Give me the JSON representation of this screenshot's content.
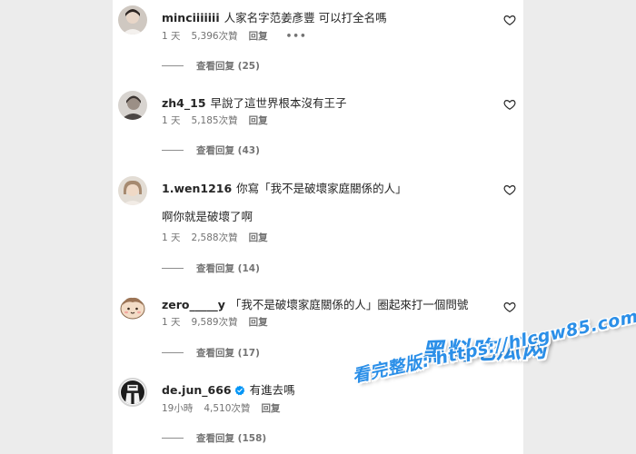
{
  "comments": [
    {
      "username": "minciiiiiii",
      "text": "人家名字范姜彥豐 可以打全名嗎",
      "extra": "",
      "time": "1 天",
      "likes": "5,396次贊",
      "reply_label": "回复",
      "more": "•••",
      "view_replies": "查看回复 (25)"
    },
    {
      "username": "zh4_15",
      "text": "早說了這世界根本沒有王子",
      "extra": "",
      "time": "1 天",
      "likes": "5,185次贊",
      "reply_label": "回复",
      "view_replies": "查看回复 (43)"
    },
    {
      "username": "1.wen1216",
      "text": "你寫「我不是破壞家庭關係的人」",
      "extra": "啊你就是破壞了啊",
      "time": "1 天",
      "likes": "2,588次贊",
      "reply_label": "回复",
      "view_replies": "查看回复 (14)"
    },
    {
      "username": "zero_____y",
      "text": "「我不是破壞家庭關係的人」圈起來打一個問號",
      "extra": "",
      "time": "1 天",
      "likes": "9,589次贊",
      "reply_label": "回复",
      "view_replies": "查看回复 (17)"
    },
    {
      "username": "de.jun_666",
      "text": "有進去嗎",
      "extra": "",
      "time": "19小時",
      "likes": "4,510次贊",
      "reply_label": "回复",
      "view_replies": "查看回复 (158)"
    }
  ],
  "watermark": {
    "line1": "黑料吃瓜网",
    "line2": "看完整版: https://hlcgw85.com"
  },
  "colors": {
    "background": "#ececec",
    "panel": "#ffffff",
    "meta_text": "#737373",
    "verified": "#0095f6",
    "watermark": "#2b8fe8"
  },
  "icons": {
    "like": "heart-outline-icon",
    "verified": "verified-badge-icon"
  }
}
